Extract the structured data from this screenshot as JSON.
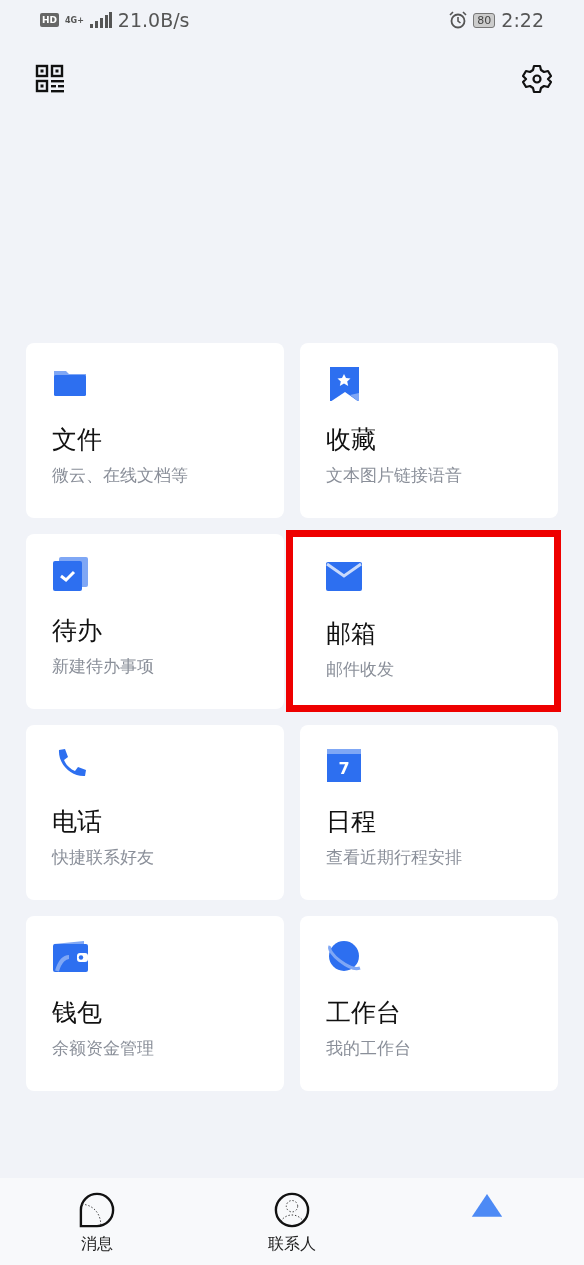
{
  "status_bar": {
    "hd_badge": "HD",
    "network": "4G+",
    "speed": "21.0B/s",
    "battery": "80",
    "time": "2:22"
  },
  "tile_rows": [
    {
      "tiles": [
        {
          "kind": "folder",
          "title": "文件",
          "subtitle": "微云、在线文档等",
          "highlighted": false
        },
        {
          "kind": "bookmark",
          "title": "收藏",
          "subtitle": "文本图片链接语音",
          "highlighted": false
        }
      ]
    },
    {
      "tiles": [
        {
          "kind": "todo",
          "title": "待办",
          "subtitle": "新建待办事项",
          "highlighted": false
        },
        {
          "kind": "mail",
          "title": "邮箱",
          "subtitle": "邮件收发",
          "highlighted": true
        }
      ]
    },
    {
      "tiles": [
        {
          "kind": "phone",
          "title": "电话",
          "subtitle": "快捷联系好友",
          "highlighted": false
        },
        {
          "kind": "calendar",
          "icon_text": "7",
          "title": "日程",
          "subtitle": "查看近期行程安排",
          "highlighted": false
        }
      ]
    },
    {
      "tiles": [
        {
          "kind": "wallet",
          "title": "钱包",
          "subtitle": "余额资金管理",
          "highlighted": false
        },
        {
          "kind": "planet",
          "title": "工作台",
          "subtitle": "我的工作台",
          "highlighted": false
        }
      ]
    }
  ],
  "bottom_nav": [
    {
      "kind": "chat",
      "label": "消息",
      "selected": false
    },
    {
      "kind": "contact",
      "label": "联系人",
      "selected": false
    },
    {
      "kind": "triangle",
      "selected": true
    }
  ]
}
